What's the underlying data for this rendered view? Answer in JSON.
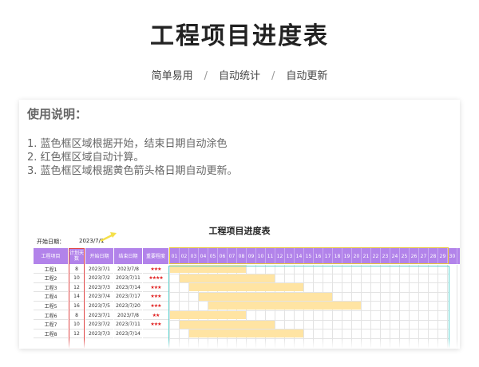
{
  "hero": {
    "title": "工程项目进度表"
  },
  "subnav": {
    "items": [
      "简单易用",
      "自动统计",
      "自动更新"
    ],
    "separator": "/"
  },
  "instructions": {
    "title": "使用说明：",
    "lines": [
      "1. 蓝色框区域根据开始，结束日期自动涂色",
      "2. 红色框区域自动计算。",
      "3. 蓝色框区域根据黄色箭头格日期自动更新。"
    ]
  },
  "sheet": {
    "title": "工程项目进度表",
    "start_label": "开始日期：",
    "start_value": "2023/7/1",
    "headers": [
      "工程项目",
      "计划天数",
      "开始日期",
      "结束日期",
      "重要程度"
    ],
    "days": [
      "01",
      "02",
      "03",
      "04",
      "05",
      "06",
      "07",
      "08",
      "09",
      "10",
      "11",
      "12",
      "13",
      "14",
      "15",
      "16",
      "17",
      "18",
      "19",
      "20",
      "21",
      "22",
      "23",
      "24",
      "25",
      "26",
      "27",
      "28",
      "29",
      "30",
      "3"
    ],
    "rows": [
      {
        "name": "工程1",
        "days": "8",
        "start": "2023/7/1",
        "end": "2023/7/8",
        "stars": "★★★"
      },
      {
        "name": "工程2",
        "days": "10",
        "start": "2023/7/2",
        "end": "2023/7/11",
        "stars": "★★★★"
      },
      {
        "name": "工程3",
        "days": "12",
        "start": "2023/7/3",
        "end": "2023/7/14",
        "stars": "★★★"
      },
      {
        "name": "工程4",
        "days": "14",
        "start": "2023/7/4",
        "end": "2023/7/17",
        "stars": "★★★"
      },
      {
        "name": "工程5",
        "days": "16",
        "start": "2023/7/5",
        "end": "2023/7/20",
        "stars": "★★★"
      },
      {
        "name": "工程6",
        "days": "8",
        "start": "2023/7/1",
        "end": "2023/7/8",
        "stars": "★★"
      },
      {
        "name": "工程7",
        "days": "10",
        "start": "2023/7/2",
        "end": "2023/7/11",
        "stars": "★★★"
      },
      {
        "name": "工程8",
        "days": "12",
        "start": "2023/7/3",
        "end": "2023/7/14",
        "stars": ""
      }
    ]
  },
  "colors": {
    "header": "#b283ea",
    "bar": "#ffe4a3",
    "red_frame": "#e04848",
    "cyan_frame": "#5fd3d0",
    "yellow_frame": "#e8c53a",
    "star": "#e02020"
  }
}
